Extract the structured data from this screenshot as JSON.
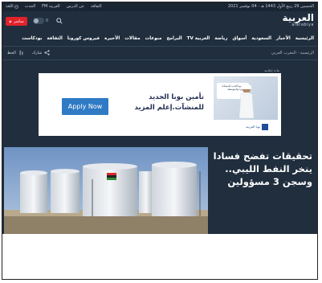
{
  "utilbar": {
    "date": "الخميس 29 ربيع الأول 1443 هـ - 04 نوفمبر 2021",
    "links": [
      "الثقافة",
      "عن الدرس",
      "العربية FM",
      "الحدث",
      "اللغة"
    ]
  },
  "header": {
    "logo_ar": "العربية",
    "logo_en": "alarabiya",
    "live_label": "مباشر",
    "toggle_label": "0"
  },
  "nav": {
    "items": [
      "الرئيسية",
      "الأخبار",
      "السعودية",
      "أسواق",
      "رياضة",
      "العربية TV",
      "البرامج",
      "منوعات",
      "مقالات",
      "الأخيرة",
      "فيروس كورونا",
      "الثقافة",
      "بودكاست"
    ]
  },
  "sharerow": {
    "breadcrumb": "الرئيسية - المغرب العربي",
    "share_label": "شارك",
    "font_label": "الخط"
  },
  "ad": {
    "label": "مادة إعلانية",
    "apply_label": "Apply Now",
    "headline": "تأمين بوبا الجديد للمنشآت.إعلم المزيد",
    "bubble_text": "تأمين بوبا الجديد للمنشآت الصغيرة والمتوسطة",
    "logo_text": "بوبا العربية"
  },
  "hero": {
    "title": "تحقيقات تفضح فسادا ينخر النفط الليبي.. وسجن 3 مسؤولين"
  },
  "colors": {
    "header_bg": "#202e3e",
    "live_red": "#e0222b",
    "apply_blue": "#2f7ac4"
  }
}
